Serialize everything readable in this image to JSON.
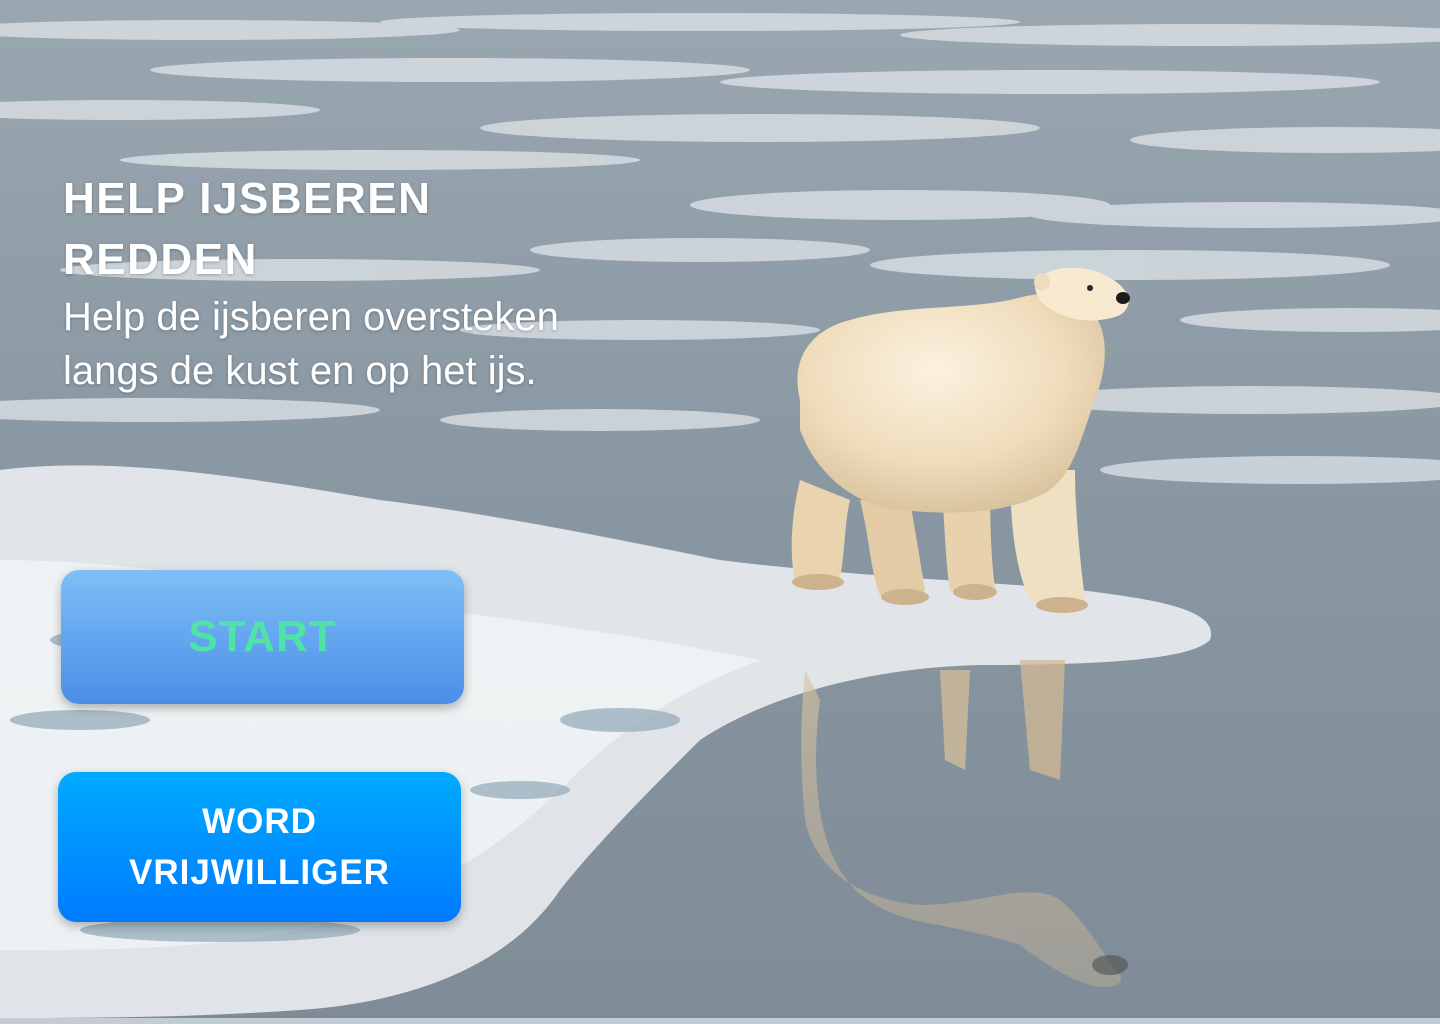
{
  "hero": {
    "title": "HELP IJSBEREN REDDEN",
    "subtitle": "Help de ijsberen oversteken langs de kust en op het ijs."
  },
  "buttons": {
    "start_label": "START",
    "volunteer_line1": "WORD",
    "volunteer_line2": "VRIJWILLIGER"
  },
  "colors": {
    "start_gradient_top": "#7fbff5",
    "start_gradient_bottom": "#4a8ee9",
    "start_text": "#4fe3a6",
    "volunteer_gradient_top": "#00aaff",
    "volunteer_gradient_bottom": "#007bff",
    "volunteer_text": "#ffffff"
  },
  "background": {
    "scene": "polar-bear-on-ice-floe-photo"
  }
}
